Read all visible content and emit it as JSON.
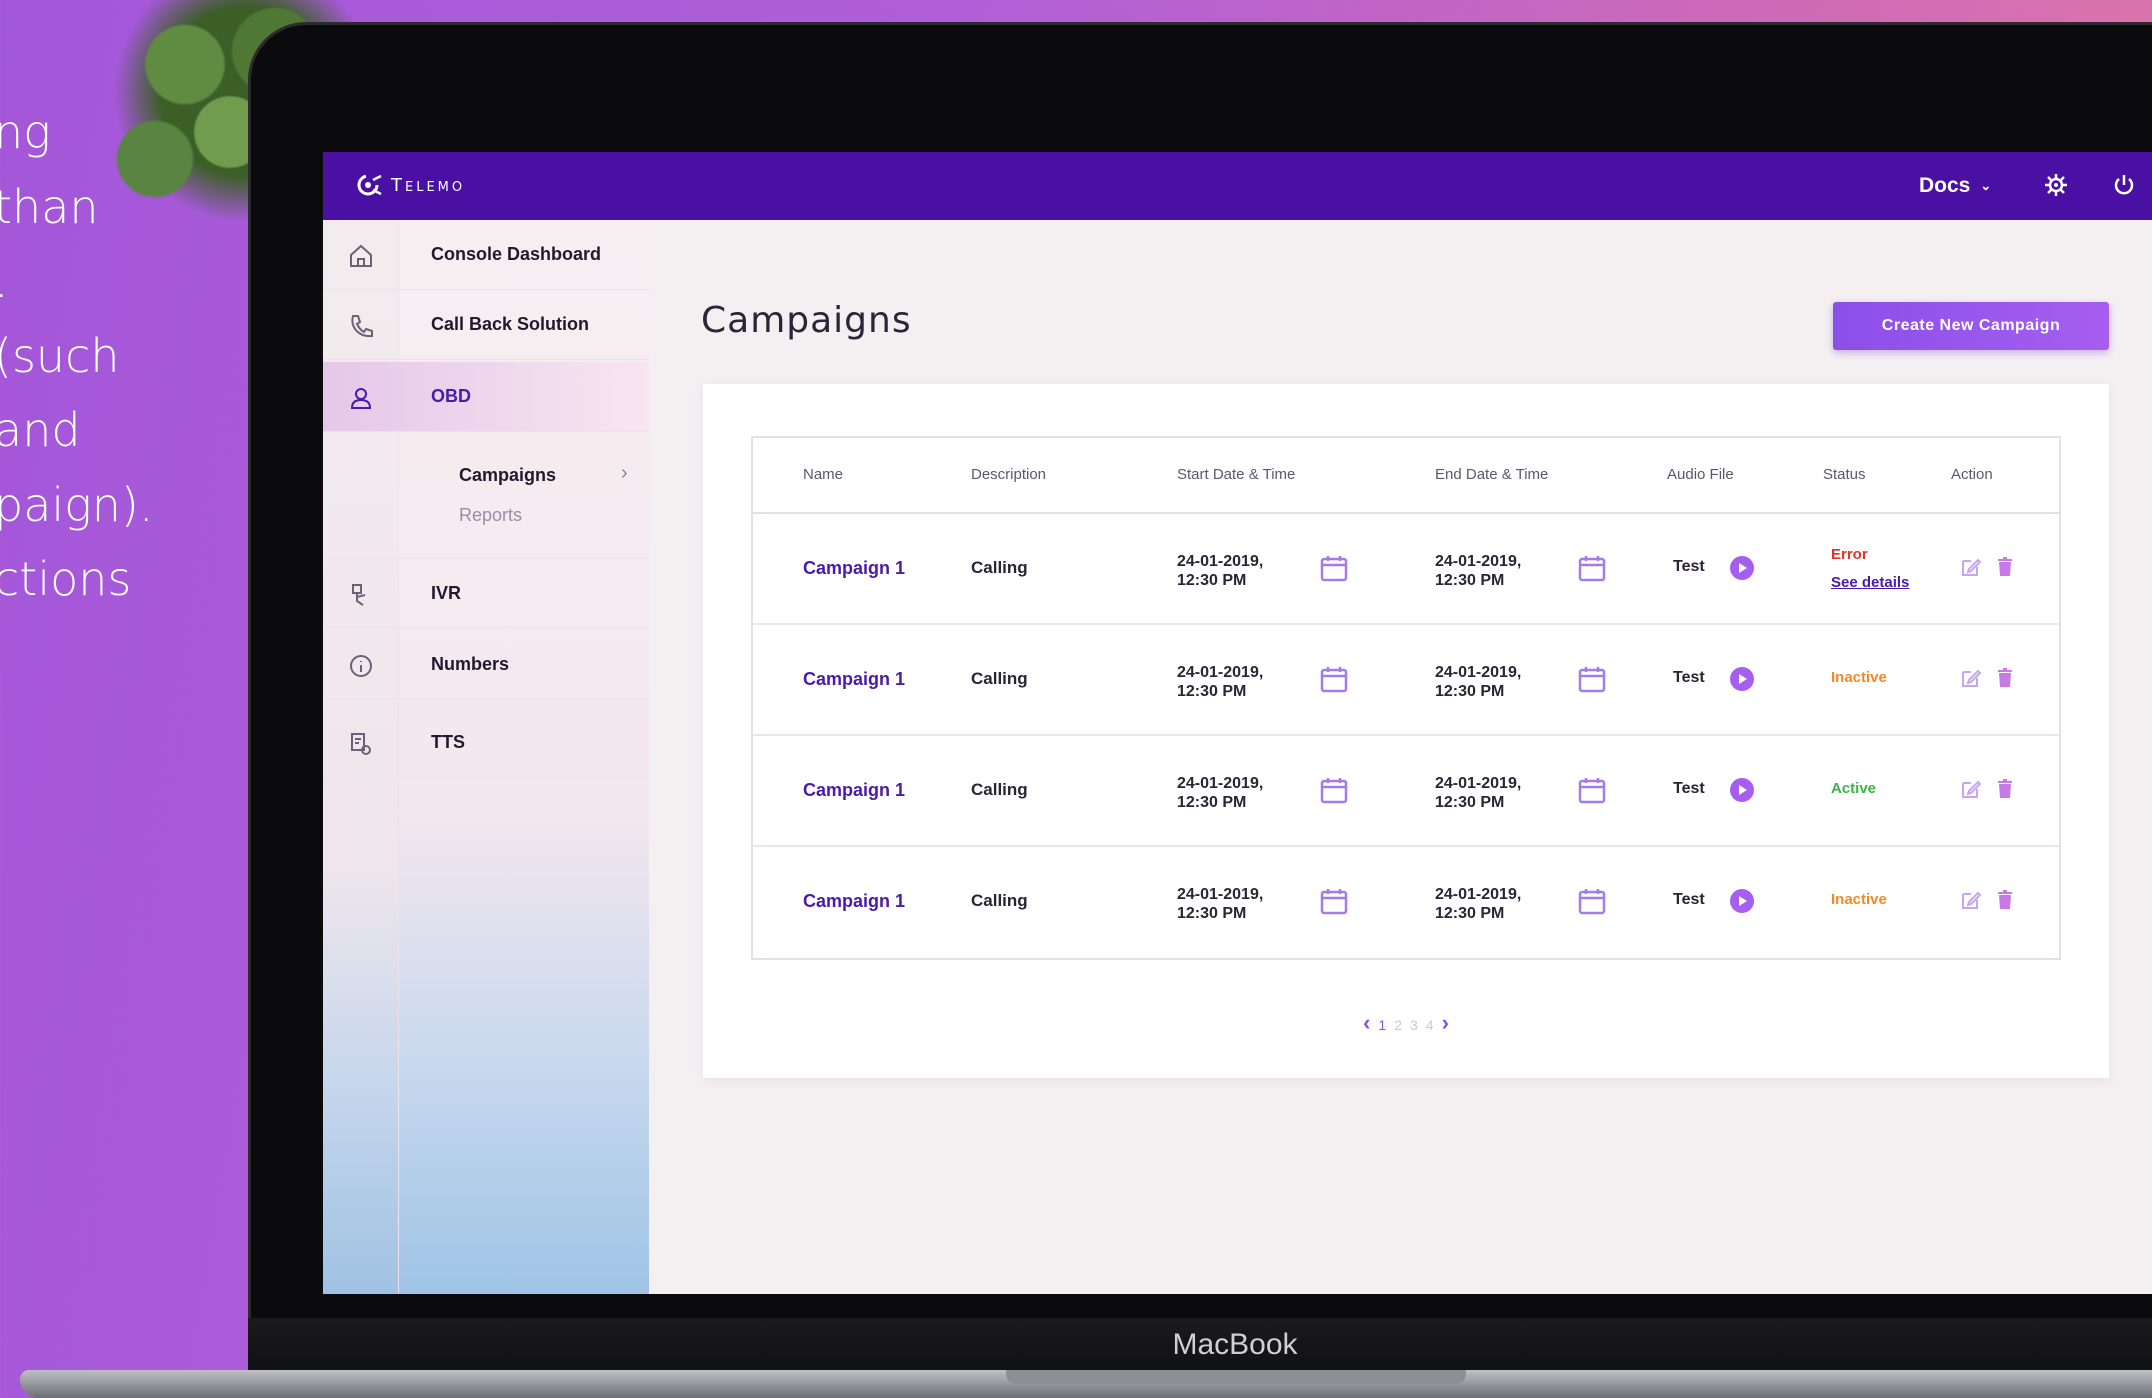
{
  "marketing_text": {
    "lines": [
      "ng",
      "than",
      ".",
      "(such",
      "and",
      "paign).",
      "ctions"
    ]
  },
  "laptop": {
    "label": "MacBook"
  },
  "app": {
    "brand": "Telemo",
    "accent": "#4a0fa3",
    "header": {
      "docs_label": "Docs",
      "icons": [
        "chevron-down-icon",
        "gear-icon",
        "power-icon"
      ]
    },
    "sidebar": {
      "items": [
        {
          "label": "Console Dashboard",
          "icon": "home-icon"
        },
        {
          "label": "Call Back Solution",
          "icon": "phone-icon"
        },
        {
          "label": "OBD",
          "icon": "user-icon",
          "active": true
        },
        {
          "label": "IVR",
          "icon": "ivr-icon"
        },
        {
          "label": "Numbers",
          "icon": "info-icon"
        },
        {
          "label": "TTS",
          "icon": "tts-icon"
        }
      ],
      "sub_items": [
        {
          "label": "Campaigns",
          "selected": true
        },
        {
          "label": "Reports",
          "selected": false
        }
      ]
    },
    "main": {
      "title": "Campaigns",
      "create_button": "Create New Campaign",
      "table": {
        "columns": [
          "Name",
          "Description",
          "Start Date & Time",
          "End Date & Time",
          "Audio File",
          "Status",
          "Action"
        ],
        "rows": [
          {
            "name": "Campaign 1",
            "description": "Calling",
            "start_date": "24-01-2019,",
            "start_time": "12:30 PM",
            "end_date": "24-01-2019,",
            "end_time": "12:30 PM",
            "audio": "Test",
            "status": "Error",
            "status_color": "#e4322b",
            "status_link": "See details"
          },
          {
            "name": "Campaign 1",
            "description": "Calling",
            "start_date": "24-01-2019,",
            "start_time": "12:30 PM",
            "end_date": "24-01-2019,",
            "end_time": "12:30 PM",
            "audio": "Test",
            "status": "Inactive",
            "status_color": "#f08a24"
          },
          {
            "name": "Campaign 1",
            "description": "Calling",
            "start_date": "24-01-2019,",
            "start_time": "12:30 PM",
            "end_date": "24-01-2019,",
            "end_time": "12:30 PM",
            "audio": "Test",
            "status": "Active",
            "status_color": "#3cb34a"
          },
          {
            "name": "Campaign 1",
            "description": "Calling",
            "start_date": "24-01-2019,",
            "start_time": "12:30 PM",
            "end_date": "24-01-2019,",
            "end_time": "12:30 PM",
            "audio": "Test",
            "status": "Inactive",
            "status_color": "#f08a24"
          }
        ]
      },
      "pagination": {
        "prev": "‹",
        "pages": [
          "1",
          "2",
          "3",
          "4"
        ],
        "current": "1",
        "next": "›"
      }
    }
  }
}
